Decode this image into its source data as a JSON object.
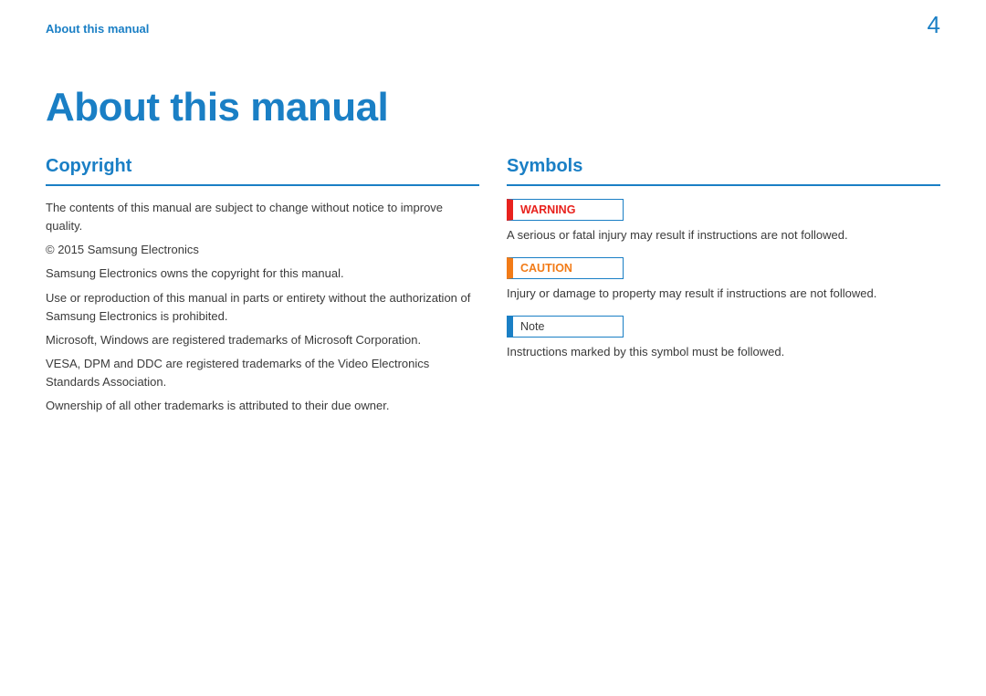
{
  "header": {
    "breadcrumb": "About this manual",
    "page_number": "4"
  },
  "title": "About this manual",
  "left": {
    "heading": "Copyright",
    "paragraphs": [
      "The contents of this manual are subject to change without notice to improve quality.",
      "© 2015 Samsung Electronics",
      "Samsung Electronics owns the copyright for this manual.",
      "Use or reproduction of this manual in parts or entirety without the authorization of Samsung Electronics is prohibited.",
      "Microsoft, Windows are registered trademarks of Microsoft Corporation.",
      "VESA, DPM and DDC are registered trademarks of the Video Electronics Standards Association.",
      "Ownership of all other trademarks is attributed to their due owner."
    ]
  },
  "right": {
    "heading": "Symbols",
    "items": [
      {
        "label": "WARNING",
        "class": "warning",
        "desc": "A serious or fatal injury may result if instructions are not followed."
      },
      {
        "label": "CAUTION",
        "class": "caution",
        "desc": "Injury or damage to property may result if instructions are not followed."
      },
      {
        "label": "Note",
        "class": "note",
        "desc": "Instructions marked by this symbol must be followed."
      }
    ]
  }
}
